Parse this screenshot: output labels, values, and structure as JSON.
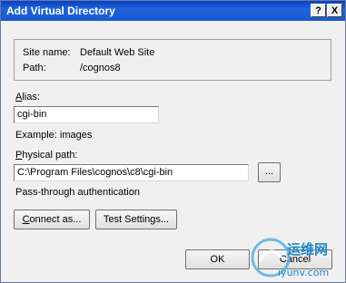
{
  "window": {
    "title": "Add Virtual Directory",
    "help_glyph": "?",
    "close_glyph": "X"
  },
  "info": {
    "site_name_label": "Site name:",
    "site_name_value": "Default Web Site",
    "path_label": "Path:",
    "path_value": "/cognos8"
  },
  "alias": {
    "label_hotkey": "A",
    "label_rest": "lias:",
    "value": "cgi-bin",
    "example": "Example: images"
  },
  "physical_path": {
    "label_hotkey": "P",
    "label_rest": "hysical path:",
    "value": "C:\\Program Files\\cognos\\c8\\cgi-bin",
    "browse_label": "..."
  },
  "auth": {
    "text": "Pass-through authentication"
  },
  "buttons": {
    "connect_hotkey": "C",
    "connect_rest": "onnect as...",
    "test_settings": "Test Settings...",
    "ok": "OK",
    "cancel": "Cancel"
  },
  "watermark": {
    "text_cn": "运维网",
    "text_url": "iyunv.com",
    "color": "#1e88c8"
  }
}
